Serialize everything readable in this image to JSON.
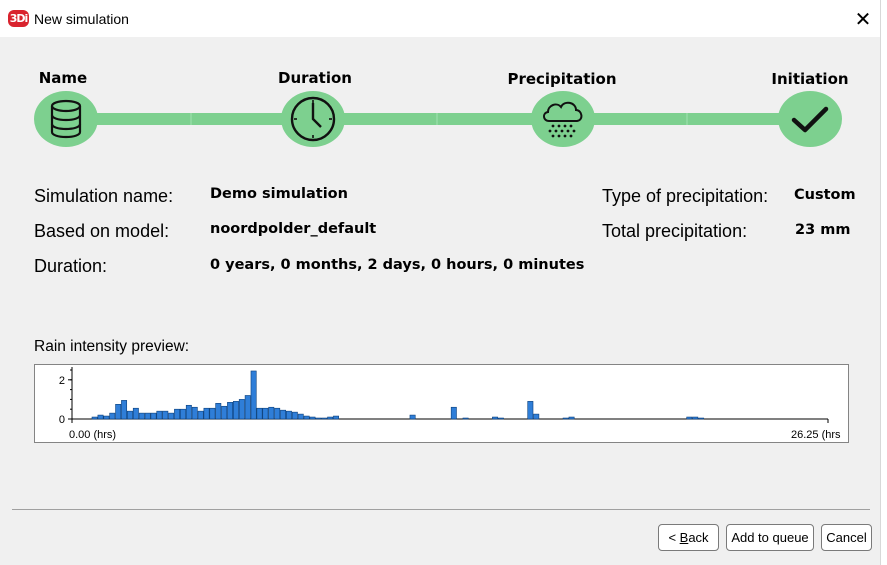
{
  "window": {
    "title": "New simulation",
    "logo_text": "3Di",
    "close_glyph": "✕"
  },
  "steps": [
    {
      "label": "Name",
      "icon": "database-icon"
    },
    {
      "label": "Duration",
      "icon": "clock-icon"
    },
    {
      "label": "Precipitation",
      "icon": "rain-cloud-icon"
    },
    {
      "label": "Initiation",
      "icon": "checkmark-icon"
    }
  ],
  "summary": {
    "simulation_name_label": "Simulation name:",
    "simulation_name_value": "Demo simulation",
    "model_label": "Based on model:",
    "model_value": "noordpolder_default",
    "duration_label": "Duration:",
    "duration_value": "0 years, 0 months, 2 days, 0 hours, 0 minutes",
    "precip_type_label": "Type of precipitation:",
    "precip_type_value": "Custom",
    "total_precip_label": "Total precipitation:",
    "total_precip_value": "23 mm"
  },
  "chart_title": "Rain intensity preview:",
  "chart_data": {
    "type": "bar",
    "title": "Rain intensity preview:",
    "xlabel_start": "0.00 (hrs)",
    "xlabel_end": "26.25 (hrs",
    "x_range": [
      0.0,
      26.25
    ],
    "ylim": [
      0,
      2.5
    ],
    "y_ticks": [
      "2",
      "0"
    ],
    "bar_color": "#2f7ed8",
    "values": [
      0.1,
      0.2,
      0.15,
      0.3,
      0.75,
      0.95,
      0.4,
      0.55,
      0.3,
      0.3,
      0.3,
      0.4,
      0.4,
      0.3,
      0.5,
      0.5,
      0.7,
      0.6,
      0.4,
      0.55,
      0.55,
      0.8,
      0.65,
      0.85,
      0.9,
      1.0,
      1.2,
      2.45,
      0.55,
      0.55,
      0.6,
      0.55,
      0.45,
      0.4,
      0.35,
      0.25,
      0.15,
      0.1,
      0.05,
      0.05,
      0.1,
      0.15,
      0.0,
      0,
      0,
      0,
      0,
      0,
      0,
      0,
      0,
      0,
      0,
      0,
      0.2,
      0,
      0,
      0,
      0,
      0,
      0,
      0.6,
      0,
      0.05,
      0,
      0,
      0,
      0,
      0.1,
      0.05,
      0,
      0,
      0,
      0,
      0.9,
      0.25,
      0,
      0,
      0,
      0,
      0.05,
      0.1,
      0,
      0,
      0,
      0,
      0,
      0,
      0,
      0,
      0,
      0,
      0,
      0,
      0,
      0,
      0,
      0,
      0,
      0,
      0,
      0.1,
      0.1,
      0.05,
      0,
      0,
      0,
      0,
      0,
      0,
      0,
      0,
      0,
      0,
      0,
      0,
      0,
      0,
      0,
      0,
      0,
      0,
      0,
      0,
      0
    ]
  },
  "buttons": {
    "back_pre": "< ",
    "back_underlined": "B",
    "back_post": "ack",
    "add_to_queue": "Add to queue",
    "cancel": "Cancel"
  }
}
